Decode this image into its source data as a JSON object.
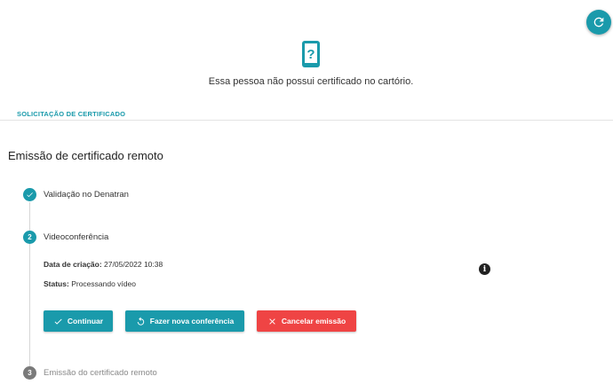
{
  "header": {
    "refresh_icon": "refresh-icon",
    "phone_icon": "phone-question-icon",
    "no_certificate_message": "Essa pessoa não possui certificado no cartório."
  },
  "section": {
    "tab_label": "SOLICITAÇÃO DE CERTIFICADO"
  },
  "page": {
    "title": "Emissão de certificado remoto"
  },
  "steps": [
    {
      "number": "1",
      "label": "Validação no Denatran",
      "status": "done"
    },
    {
      "number": "2",
      "label": "Videoconferência",
      "status": "active"
    },
    {
      "number": "3",
      "label": "Emissão do certificado remoto",
      "status": "pending"
    }
  ],
  "details": {
    "creation_label": "Data de criação:",
    "creation_value": "27/05/2022 10:38",
    "status_label": "Status:",
    "status_value": "Processando vídeo"
  },
  "actions": {
    "continue_label": "Continuar",
    "redo_label": "Fazer nova conferência",
    "cancel_label": "Cancelar emissão"
  },
  "colors": {
    "primary": "#1a9aab",
    "danger": "#ef4444",
    "pending": "#7a7a7a"
  }
}
